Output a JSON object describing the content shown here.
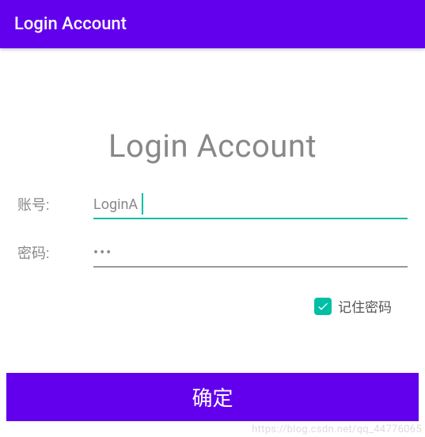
{
  "app_bar": {
    "title": "Login Account"
  },
  "form": {
    "heading": "Login Account",
    "username_label": "账号:",
    "username_value": "LoginA",
    "password_label": "密码:",
    "password_value": "•••",
    "remember_label": "记住密码",
    "remember_checked": true,
    "confirm_label": "确定"
  },
  "colors": {
    "primary": "#6200EE",
    "accent": "#00BFA5"
  },
  "watermark": "https://blog.csdn.net/qq_44776065"
}
